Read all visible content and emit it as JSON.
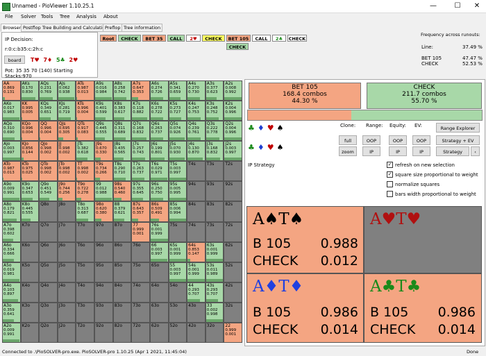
{
  "window": {
    "title": "Unnamed - PioViewer 1.10.25.1",
    "minimize": "—",
    "maximize": "☐",
    "close": "✕"
  },
  "menu": [
    "File",
    "Solver",
    "Tools",
    "Tree",
    "Analysis",
    "About"
  ],
  "tabs": [
    "Browser",
    "Postflop Tree Building and Calculations",
    "Preflop",
    "Tree information"
  ],
  "decision": {
    "label": "IP Decision:",
    "line": "r:0:c:b35:c:2h:c",
    "board_button": "board",
    "board_cards": [
      {
        "t": "T♥",
        "c": "#c00000"
      },
      {
        "t": "7♦",
        "c": "#c00000"
      },
      {
        "t": "5♣",
        "c": "#1a8a1a"
      },
      {
        "t": "2♥",
        "c": "#c00000"
      }
    ],
    "pot": "Pot: 35 35 70 (140) Starting Stacks:970"
  },
  "tree": {
    "row1": [
      {
        "t": "Root",
        "bg": "#f4a582"
      },
      {
        "t": "CHECK",
        "bg": "#a8d8a8"
      },
      {
        "t": "BET 35",
        "bg": "#f4a582"
      },
      {
        "t": "CALL",
        "bg": "#a8d8a8"
      },
      {
        "t": "2♥",
        "bg": "#ffffff",
        "fg": "#c00000"
      },
      {
        "t": "CHECK",
        "bg": "#ffff60"
      },
      {
        "t": "BET 105",
        "bg": "#f4a582"
      },
      {
        "t": "CALL",
        "bg": "#ffffff"
      },
      {
        "t": "2♣",
        "bg": "#ffffff",
        "fg": "#1a8a1a"
      },
      {
        "t": "CHECK",
        "bg": "#ffffff"
      }
    ],
    "row2": {
      "t": "CHECK",
      "bg": "#a8d8a8"
    }
  },
  "frequency": {
    "title": "Frequency across runouts:",
    "rows": [
      {
        "k": "Line:",
        "v": "37.49 %"
      },
      {
        "k": "BET 105",
        "v": "47.47 %"
      },
      {
        "k": "CHECK",
        "v": "52.53 %"
      }
    ]
  },
  "summary": {
    "bet": {
      "label": "BET 105",
      "combos": "168.4 combos",
      "pct": "44.30 %",
      "color": "#f4a582"
    },
    "check": {
      "label": "CHECK",
      "combos": "211.7 combos",
      "pct": "55.70 %",
      "color": "#a8d8a8"
    },
    "bet_fraction": 0.443
  },
  "suits": [
    {
      "t": "♣",
      "c": "#1a8a1a"
    },
    {
      "t": "♦",
      "c": "#1f3fcf"
    },
    {
      "t": "♥",
      "c": "#c00000"
    },
    {
      "t": "♠",
      "c": "#000000"
    }
  ],
  "controls": {
    "headers": [
      "Clone:",
      "Range:",
      "Equity:",
      "EV:"
    ],
    "buttons_row1": [
      "full",
      "OOP",
      "OOP",
      "OOP"
    ],
    "buttons_row2": [
      "zoom",
      "IP",
      "IP",
      "IP"
    ],
    "range_explorer": "Range Explorer",
    "strategy_ev": "Strategy + EV",
    "strategy": "Strategy",
    "arrow": "‹",
    "ip_strategy": "IP Strategy",
    "checkboxes": [
      {
        "label": "refresh on new selection",
        "checked": true
      },
      {
        "label": "square size proportional to weight",
        "checked": true
      },
      {
        "label": "normalize squares",
        "checked": false
      },
      {
        "label": "bars width proportional to weight",
        "checked": false
      }
    ]
  },
  "hands_detail": [
    {
      "combo": "A♠T♠",
      "color": "#000000",
      "bg": "#f4a582",
      "bet": "B 105",
      "bet_v": "0.988",
      "check": "CHECK",
      "check_v": "0.012"
    },
    {
      "combo": "A♥T♥",
      "color": "#b01010",
      "bg": "#808080",
      "bet": "",
      "bet_v": "",
      "check": "",
      "check_v": ""
    },
    {
      "combo": "A♦T♦",
      "color": "#2040e0",
      "bg": "#f4a582",
      "bet": "B 105",
      "bet_v": "0.986",
      "check": "CHECK",
      "check_v": "0.014"
    },
    {
      "combo": "A♣T♣",
      "color": "#1a8a1a",
      "bg": "#f4a582",
      "bet": "B 105",
      "bet_v": "0.986",
      "check": "CHECK",
      "check_v": "0.014"
    }
  ],
  "matrix": {
    "rows": [
      [
        [
          "AA",
          "0.869",
          "0.131",
          "R"
        ],
        [
          "AKs",
          "0.170",
          "0.830",
          "G"
        ],
        [
          "AQs",
          "0.231",
          "0.769",
          "G"
        ],
        [
          "AJs",
          "0.062",
          "0.938",
          "G"
        ],
        [
          "ATs",
          "0.987",
          "0.013",
          "R"
        ],
        [
          "A9s",
          "0.016",
          "0.984",
          "G"
        ],
        [
          "A8s",
          "0.258",
          "0.742",
          "G"
        ],
        [
          "A7s",
          "0.647",
          "0.353",
          "R"
        ],
        [
          "A6s",
          "0.274",
          "0.726",
          "G"
        ],
        [
          "A5s",
          "0.341",
          "0.659",
          "G"
        ],
        [
          "A4s",
          "0.270",
          "0.730",
          "G"
        ],
        [
          "A3s",
          "0.377",
          "0.623",
          "G"
        ],
        [
          "A2s",
          "0.008",
          "0.992",
          "G"
        ]
      ],
      [
        [
          "AKo",
          "0.017",
          "0.983",
          "G"
        ],
        [
          "KK",
          "0.995",
          "0.005",
          "R"
        ],
        [
          "KQs",
          "0.349",
          "0.651",
          "G"
        ],
        [
          "KJs",
          "0.281",
          "0.719",
          "G"
        ],
        [
          "KTs",
          "0.996",
          "0.004",
          "R"
        ],
        [
          "K9s",
          "0.401",
          "0.599",
          "G"
        ],
        [
          "K8s",
          "0.383",
          "0.617",
          "G"
        ],
        [
          "K7s",
          "0.118",
          "0.882",
          "G"
        ],
        [
          "K6s",
          "0.278",
          "0.722",
          "G"
        ],
        [
          "K5s",
          "0.273",
          "0.727",
          "G"
        ],
        [
          "K4s",
          "0.247",
          "0.753",
          "G"
        ],
        [
          "K3s",
          "0.248",
          "0.752",
          "G"
        ],
        [
          "K2s",
          "0.004",
          "0.996",
          "G"
        ]
      ],
      [
        [
          "AQo",
          "0.310",
          "0.690",
          "G"
        ],
        [
          "KQo",
          "0.996",
          "0.004",
          "R"
        ],
        [
          "QQ",
          "0.996",
          "0.004",
          "R"
        ],
        [
          "QJs",
          "0.695",
          "0.305",
          "R"
        ],
        [
          "QTs",
          "0.917",
          "0.083",
          "R"
        ],
        [
          "Q9s",
          "0.445",
          "0.555",
          "G"
        ],
        [
          "Q8s",
          "0.311",
          "0.689",
          "G"
        ],
        [
          "Q7s",
          "0.168",
          "0.832",
          "G"
        ],
        [
          "Q6s",
          "0.263",
          "0.737",
          "G"
        ],
        [
          "Q5s",
          "0.074",
          "0.926",
          "G"
        ],
        [
          "Q4s",
          "0.239",
          "0.761",
          "G"
        ],
        [
          "Q3s",
          "0.222",
          "0.778",
          "G"
        ],
        [
          "Q2s",
          "0.004",
          "0.996",
          "G"
        ]
      ],
      [
        [
          "AJo",
          "0.003",
          "0.997",
          "G"
        ],
        [
          "KJo",
          "0.856",
          "0.144",
          "R"
        ],
        [
          "QJo",
          "0.998",
          "0.002",
          "R"
        ],
        [
          "JJ",
          "0.998",
          "0.002",
          "R"
        ],
        [
          "JTs",
          "0.382",
          "0.618",
          "G"
        ],
        [
          "J9s",
          "0.670",
          "0.330",
          "R"
        ],
        [
          "J8s",
          "0.435",
          "0.565",
          "G"
        ],
        [
          "J7s",
          "0.257",
          "0.743",
          "G"
        ],
        [
          "J6s",
          "0.199",
          "0.801",
          "G"
        ],
        [
          "J5s",
          "0.070",
          "0.930",
          "G"
        ],
        [
          "J4s",
          "0.130",
          "0.870",
          "G"
        ],
        [
          "J3s",
          "0.168",
          "0.832",
          "G"
        ],
        [
          "J2s",
          "0.003",
          "0.997",
          "G"
        ]
      ],
      [
        [
          "ATo",
          "0.987",
          "0.013",
          "R"
        ],
        [
          "KTo",
          "0.975",
          "0.025",
          "R"
        ],
        [
          "QTo",
          "0.998",
          "0.002",
          "R"
        ],
        [
          "JTo",
          "0.998",
          "0.002",
          "R"
        ],
        [
          "TT",
          "0.998",
          "0.002",
          "R"
        ],
        [
          "T9s",
          "0.734",
          "0.266",
          "R"
        ],
        [
          "T8s",
          "0.290",
          "0.710",
          "G"
        ],
        [
          "T7s",
          "0.263",
          "0.737",
          "G"
        ],
        [
          "T6s",
          "0.029",
          "0.971",
          "G"
        ],
        [
          "T5s",
          "0.003",
          "0.997",
          "G"
        ],
        [
          "T4s",
          "",
          "",
          "X"
        ],
        [
          "T3s",
          "",
          "",
          "X"
        ],
        [
          "T2s",
          "",
          "",
          "X"
        ]
      ],
      [
        [
          "A9o",
          "0.009",
          "0.991",
          "G"
        ],
        [
          "K9o",
          "0.347",
          "0.653",
          "G"
        ],
        [
          "Q9o",
          "0.451",
          "0.549",
          "G"
        ],
        [
          "J9o",
          "0.744",
          "0.256",
          "R"
        ],
        [
          "T9o",
          "0.722",
          "0.278",
          "R"
        ],
        [
          "99",
          "0.012",
          "0.988",
          "G"
        ],
        [
          "98s",
          "0.540",
          "0.460",
          "R"
        ],
        [
          "97s",
          "0.355",
          "0.645",
          "G"
        ],
        [
          "96s",
          "0.250",
          "0.750",
          "G"
        ],
        [
          "95s",
          "0.005",
          "0.995",
          "G"
        ],
        [
          "94s",
          "",
          "",
          "X"
        ],
        [
          "93s",
          "",
          "",
          "X"
        ],
        [
          "92s",
          "",
          "",
          "X"
        ]
      ],
      [
        [
          "A8o",
          "0.179",
          "0.821",
          "G"
        ],
        [
          "K8o",
          "0.445",
          "0.555",
          "G"
        ],
        [
          "Q8o",
          "",
          "",
          "X"
        ],
        [
          "J8o",
          "",
          "",
          "X"
        ],
        [
          "T8o",
          "0.313",
          "0.687",
          "G"
        ],
        [
          "98o",
          "0.620",
          "0.380",
          "R"
        ],
        [
          "88",
          "0.379",
          "0.621",
          "G"
        ],
        [
          "87s",
          "0.643",
          "0.357",
          "R"
        ],
        [
          "86s",
          "0.509",
          "0.491",
          "R"
        ],
        [
          "85s",
          "0.006",
          "0.994",
          "G"
        ],
        [
          "84s",
          "",
          "",
          "X"
        ],
        [
          "83s",
          "",
          "",
          "X"
        ],
        [
          "82s",
          "",
          "",
          "X"
        ]
      ],
      [
        [
          "A7o",
          "0.398",
          "0.602",
          "G"
        ],
        [
          "K7o",
          "",
          "",
          "X"
        ],
        [
          "Q7o",
          "",
          "",
          "X"
        ],
        [
          "J7o",
          "",
          "",
          "X"
        ],
        [
          "T7o",
          "",
          "",
          "X"
        ],
        [
          "97o",
          "",
          "",
          "X"
        ],
        [
          "87o",
          "",
          "",
          "X"
        ],
        [
          "77",
          "0.999",
          "0.001",
          "R"
        ],
        [
          "76s",
          "0.001",
          "0.999",
          "G"
        ],
        [
          "75s",
          "",
          "",
          "X"
        ],
        [
          "74s",
          "",
          "",
          "X"
        ],
        [
          "73s",
          "",
          "",
          "X"
        ],
        [
          "72s",
          "",
          "",
          "X"
        ]
      ],
      [
        [
          "A6o",
          "0.334",
          "0.666",
          "G"
        ],
        [
          "K6o",
          "",
          "",
          "X"
        ],
        [
          "Q6o",
          "",
          "",
          "X"
        ],
        [
          "J6o",
          "",
          "",
          "X"
        ],
        [
          "T6o",
          "",
          "",
          "X"
        ],
        [
          "96o",
          "",
          "",
          "X"
        ],
        [
          "86o",
          "",
          "",
          "X"
        ],
        [
          "76o",
          "",
          "",
          "X"
        ],
        [
          "66",
          "0.003",
          "0.997",
          "G"
        ],
        [
          "65s",
          "0.001",
          "0.999",
          "G"
        ],
        [
          "64s",
          "0.853",
          "0.147",
          "R"
        ],
        [
          "63s",
          "0.001",
          "0.999",
          "G"
        ],
        [
          "62s",
          "",
          "",
          "X"
        ]
      ],
      [
        [
          "A5o",
          "0.019",
          "0.981",
          "G"
        ],
        [
          "K5o",
          "",
          "",
          "X"
        ],
        [
          "Q5o",
          "",
          "",
          "X"
        ],
        [
          "J5o",
          "",
          "",
          "X"
        ],
        [
          "T5o",
          "",
          "",
          "X"
        ],
        [
          "95o",
          "",
          "",
          "X"
        ],
        [
          "85o",
          "",
          "",
          "X"
        ],
        [
          "75o",
          "",
          "",
          "X"
        ],
        [
          "65o",
          "",
          "",
          "X"
        ],
        [
          "55",
          "0.003",
          "0.997",
          "G"
        ],
        [
          "54s",
          "0.001",
          "0.999",
          "G"
        ],
        [
          "53s",
          "0.011",
          "0.989",
          "G"
        ],
        [
          "52s",
          "",
          "",
          "X"
        ]
      ],
      [
        [
          "A4o",
          "0.103",
          "0.897",
          "G"
        ],
        [
          "K4o",
          "",
          "",
          "X"
        ],
        [
          "Q4o",
          "",
          "",
          "X"
        ],
        [
          "J4o",
          "",
          "",
          "X"
        ],
        [
          "T4o",
          "",
          "",
          "X"
        ],
        [
          "94o",
          "",
          "",
          "X"
        ],
        [
          "84o",
          "",
          "",
          "X"
        ],
        [
          "74o",
          "",
          "",
          "X"
        ],
        [
          "64o",
          "",
          "",
          "X"
        ],
        [
          "54o",
          "",
          "",
          "X"
        ],
        [
          "44",
          "0.293",
          "0.707",
          "G"
        ],
        [
          "43s",
          "0.293",
          "0.707",
          "G"
        ],
        [
          "42s",
          "",
          "",
          "X"
        ]
      ],
      [
        [
          "A3o",
          "0.359",
          "0.641",
          "G"
        ],
        [
          "K3o",
          "",
          "",
          "X"
        ],
        [
          "Q3o",
          "",
          "",
          "X"
        ],
        [
          "J3o",
          "",
          "",
          "X"
        ],
        [
          "T3o",
          "",
          "",
          "X"
        ],
        [
          "93o",
          "",
          "",
          "X"
        ],
        [
          "83o",
          "",
          "",
          "X"
        ],
        [
          "73o",
          "",
          "",
          "X"
        ],
        [
          "63o",
          "",
          "",
          "X"
        ],
        [
          "53o",
          "",
          "",
          "X"
        ],
        [
          "43o",
          "",
          "",
          "X"
        ],
        [
          "33",
          "0.002",
          "0.998",
          "G"
        ],
        [
          "32s",
          "",
          "",
          "X"
        ]
      ],
      [
        [
          "A2o",
          "0.009",
          "0.991",
          "G"
        ],
        [
          "K2o",
          "",
          "",
          "X"
        ],
        [
          "Q2o",
          "",
          "",
          "X"
        ],
        [
          "J2o",
          "",
          "",
          "X"
        ],
        [
          "T2o",
          "",
          "",
          "X"
        ],
        [
          "92o",
          "",
          "",
          "X"
        ],
        [
          "82o",
          "",
          "",
          "X"
        ],
        [
          "72o",
          "",
          "",
          "X"
        ],
        [
          "62o",
          "",
          "",
          "X"
        ],
        [
          "52o",
          "",
          "",
          "X"
        ],
        [
          "42o",
          "",
          "",
          "X"
        ],
        [
          "32o",
          "",
          "",
          "X"
        ],
        [
          "22",
          "0.999",
          "0.001",
          "R"
        ]
      ]
    ]
  },
  "status": {
    "left": "Connected to .\\PioSOLVER-pro.exe. PioSOLVER-pro 1.10.25 (Apr  1 2021, 11:45:04)",
    "right": "Done"
  }
}
